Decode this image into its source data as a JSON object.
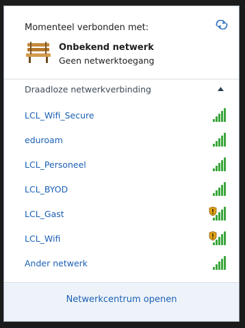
{
  "current": {
    "label": "Momenteel verbonden met:",
    "network_name": "Onbekend netwerk",
    "network_status": "Geen netwerktoegang"
  },
  "section": {
    "title": "Draadloze netwerkverbinding"
  },
  "networks": [
    {
      "name": "LCL_Wifi_Secure",
      "secured": false
    },
    {
      "name": "eduroam",
      "secured": false
    },
    {
      "name": "LCL_Personeel",
      "secured": false
    },
    {
      "name": "LCL_BYOD",
      "secured": false
    },
    {
      "name": "LCL_Gast",
      "secured": true
    },
    {
      "name": "LCL_Wifi",
      "secured": true
    },
    {
      "name": "Ander netwerk",
      "secured": false
    }
  ],
  "footer": {
    "link": "Netwerkcentrum openen"
  },
  "colors": {
    "link": "#1a5fb4",
    "signal_green": "#3aa63a",
    "shield": "#e0a41a"
  },
  "icons": {
    "refresh": "refresh-icon",
    "bench": "bench-icon",
    "collapse": "chevron-up-icon",
    "signal": "signal-bars-icon",
    "shield": "shield-warning-icon"
  }
}
